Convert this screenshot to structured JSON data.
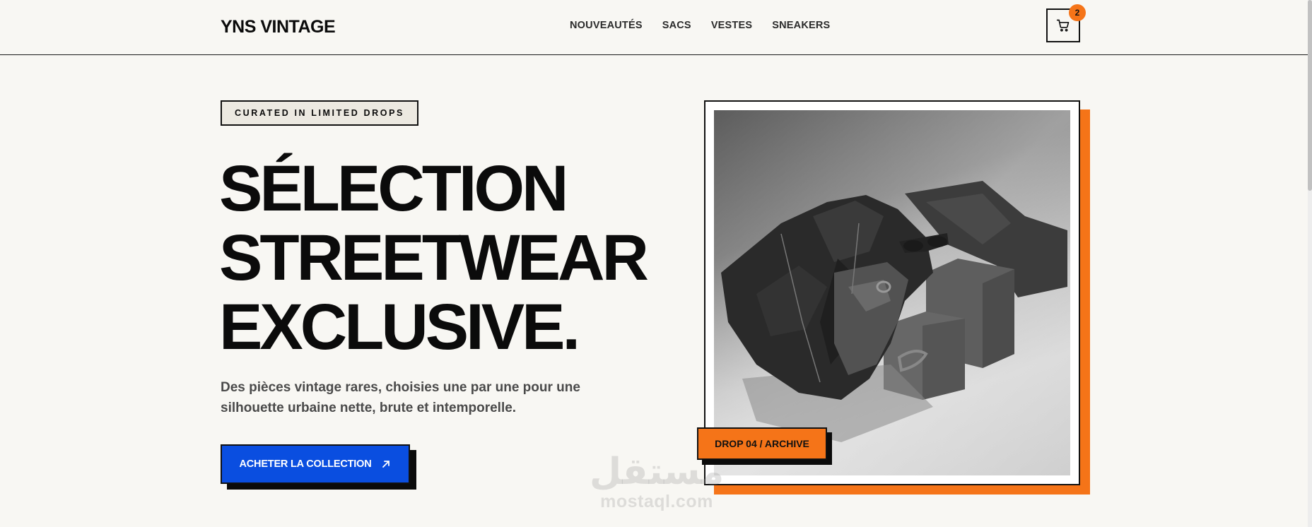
{
  "header": {
    "logo": "YNS VINTAGE",
    "nav": [
      {
        "label": "NOUVEAUTÉS"
      },
      {
        "label": "SACS"
      },
      {
        "label": "VESTES"
      },
      {
        "label": "SNEAKERS"
      }
    ],
    "cart": {
      "icon": "cart-icon",
      "count": "2"
    }
  },
  "hero": {
    "tag": "CURATED IN LIMITED DROPS",
    "headline": [
      "SÉLECTION",
      "STREETWEAR",
      "EXCLUSIVE."
    ],
    "subtitle": "Des pièces vintage rares, choisies une par une pour une silhouette urbaine nette, brute et intemporelle.",
    "cta_label": "ACHETER LA COLLECTION",
    "cta_icon": "arrow-up-right-icon",
    "drop_label": "DROP 04 / ARCHIVE"
  },
  "watermark": {
    "arabic": "مستقل",
    "latin": "mostaql.com"
  },
  "colors": {
    "background": "#f8f7f3",
    "accent_orange": "#f57418",
    "cta_blue": "#0a4ee0",
    "ink": "#0b0b0b"
  }
}
